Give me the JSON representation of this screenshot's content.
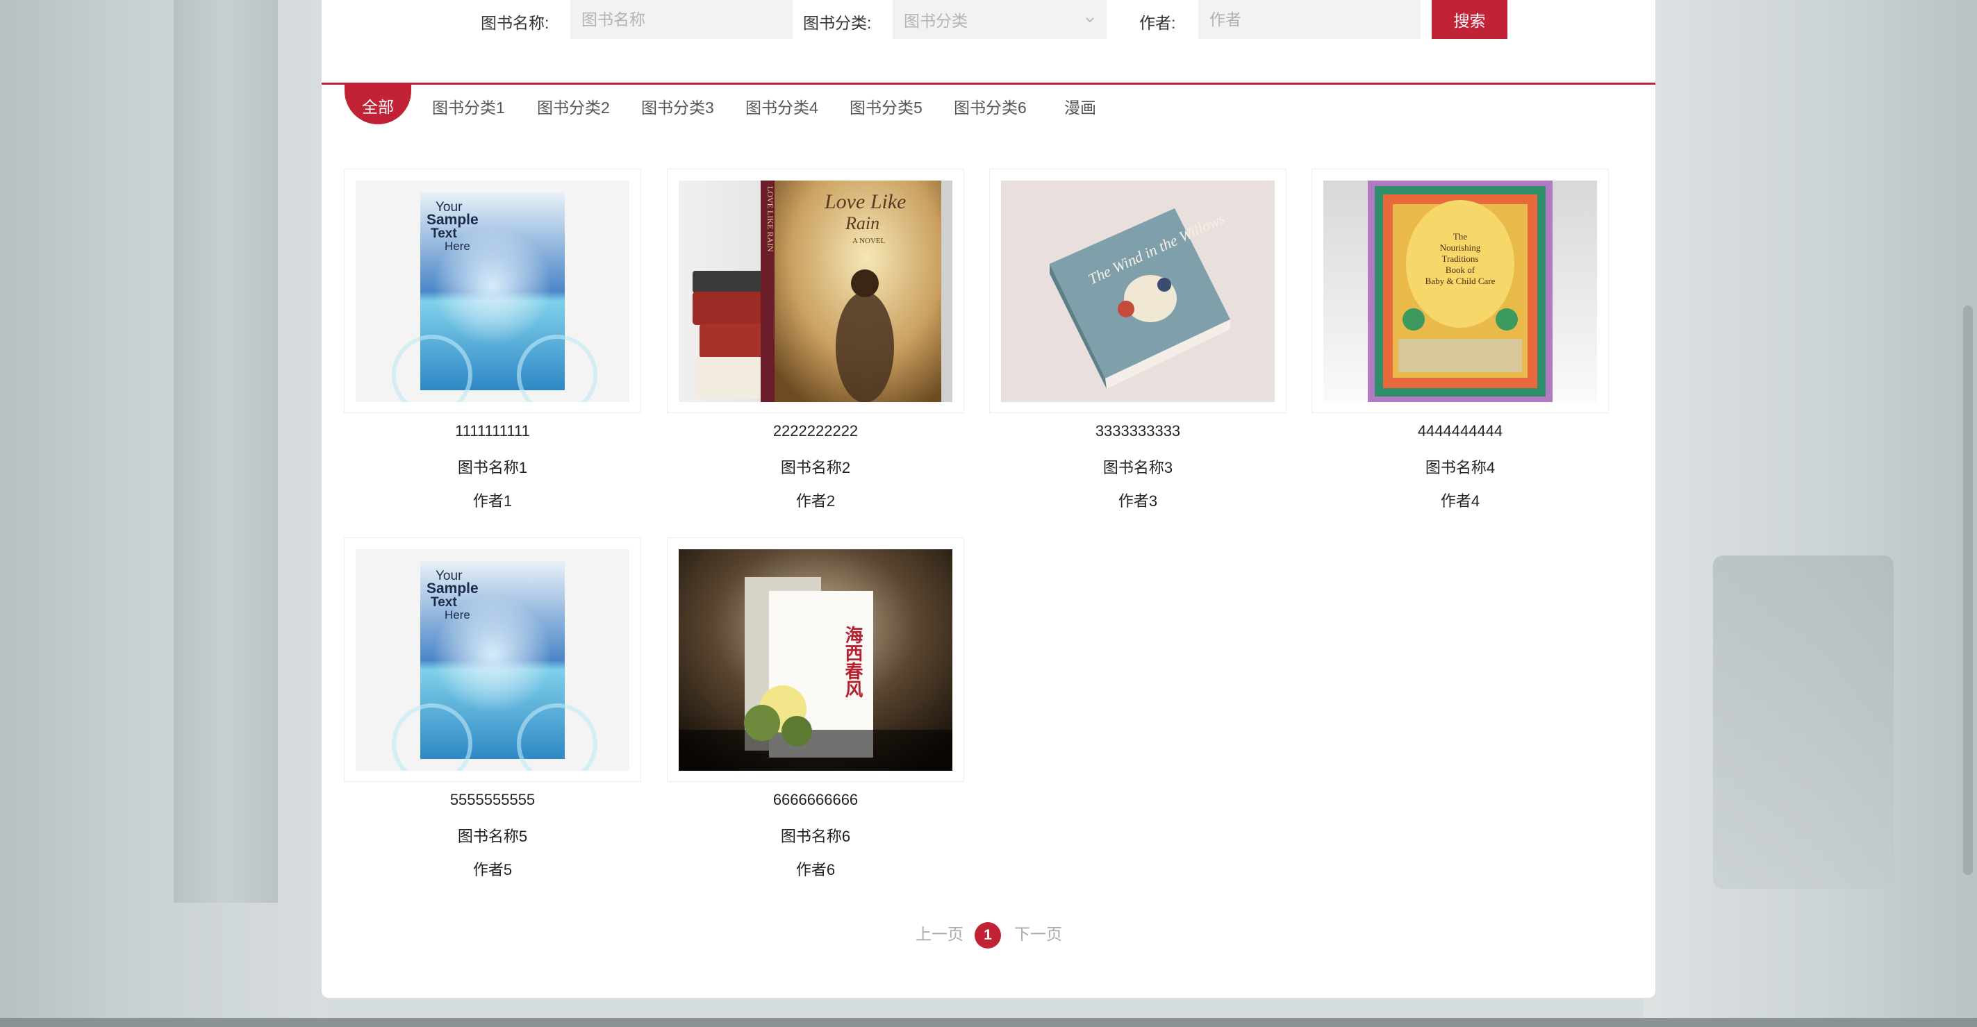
{
  "search": {
    "name_label": "图书名称:",
    "name_placeholder": "图书名称",
    "category_label": "图书分类:",
    "category_placeholder": "图书分类",
    "author_label": "作者:",
    "author_placeholder": "作者",
    "search_button": "搜索"
  },
  "tabs": [
    {
      "label": "全部",
      "active": true
    },
    {
      "label": "图书分类1"
    },
    {
      "label": "图书分类2"
    },
    {
      "label": "图书分类3"
    },
    {
      "label": "图书分类4"
    },
    {
      "label": "图书分类5"
    },
    {
      "label": "图书分类6"
    },
    {
      "label": "漫画"
    }
  ],
  "books": [
    {
      "code": "1111111111",
      "title": "图书名称1",
      "author": "作者1",
      "cover_text": [
        "Your",
        "Sample",
        "Text",
        "Here"
      ]
    },
    {
      "code": "2222222222",
      "title": "图书名称2",
      "author": "作者2",
      "cover_text": [
        "Love Like",
        "Rain",
        "A NOVEL",
        "LOVE LIKE RAIN"
      ]
    },
    {
      "code": "3333333333",
      "title": "图书名称3",
      "author": "作者3",
      "cover_text": [
        "The Wind in the Willows"
      ]
    },
    {
      "code": "4444444444",
      "title": "图书名称4",
      "author": "作者4",
      "cover_text": [
        "The",
        "Nourishing",
        "Traditions",
        "Book of",
        "Baby & Child Care"
      ]
    },
    {
      "code": "5555555555",
      "title": "图书名称5",
      "author": "作者5",
      "cover_text": [
        "Your",
        "Sample",
        "Text",
        "Here"
      ]
    },
    {
      "code": "6666666666",
      "title": "图书名称6",
      "author": "作者6",
      "cover_text": [
        "海西春风"
      ]
    }
  ],
  "pagination": {
    "prev": "上一页",
    "current": "1",
    "next": "下一页"
  },
  "colors": {
    "accent": "#c12235"
  }
}
